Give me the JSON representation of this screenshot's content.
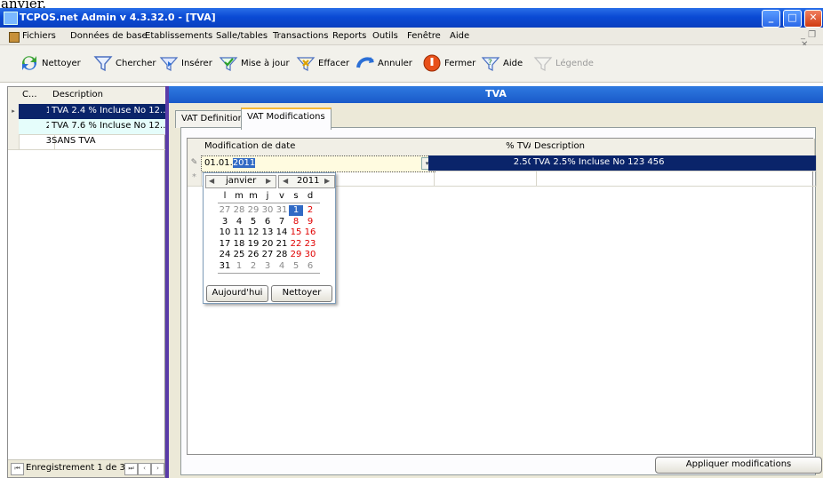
{
  "caption_fragment": "anvier.",
  "window": {
    "title": "TCPOS.net Admin v 4.3.32.0 - [TVA]"
  },
  "menu": [
    {
      "label": "Fichiers"
    },
    {
      "label": "Données de base"
    },
    {
      "label": "Etablissements"
    },
    {
      "label": "Salle/tables"
    },
    {
      "label": "Transactions"
    },
    {
      "label": "Reports"
    },
    {
      "label": "Outils"
    },
    {
      "label": "Fenêtre"
    },
    {
      "label": "Aide"
    }
  ],
  "toolbar": [
    {
      "label": "Nettoyer",
      "icon": "cleanup-icon"
    },
    {
      "label": "Chercher",
      "icon": "search-icon"
    },
    {
      "label": "Insérer",
      "icon": "insert-icon"
    },
    {
      "label": "Mise à jour",
      "icon": "update-icon"
    },
    {
      "label": "Effacer",
      "icon": "delete-icon"
    },
    {
      "label": "Annuler",
      "icon": "undo-icon"
    },
    {
      "label": "Fermer",
      "icon": "close-icon"
    },
    {
      "label": "Aide",
      "icon": "help-icon"
    },
    {
      "label": "Légende",
      "icon": "legend-icon"
    }
  ],
  "left_grid": {
    "headers": [
      "C...",
      "Description"
    ],
    "rows": [
      {
        "code": "1",
        "desc": "TVA 2.4 % Incluse No 12..."
      },
      {
        "code": "2",
        "desc": "TVA 7.6 % Incluse No 12..."
      },
      {
        "code": "3",
        "desc": "SANS TVA"
      }
    ],
    "footer": "Enregistrement 1 de 3"
  },
  "right": {
    "header": "TVA",
    "tabs": [
      "VAT Definition",
      "VAT Modifications"
    ],
    "grid": {
      "headers": [
        "Modification de date",
        "% TVA",
        "Description"
      ],
      "row": {
        "date_prefix": "01.01.",
        "date_selected": "2011",
        "pct": "2.50",
        "desc": "TVA 2.5% Incluse No 123 456"
      }
    },
    "apply_label": "Appliquer modifications"
  },
  "datepicker": {
    "month": "janvier",
    "year": "2011",
    "weekdays": [
      "l",
      "m",
      "m",
      "j",
      "v",
      "s",
      "d"
    ],
    "weeks": [
      [
        "27",
        "28",
        "29",
        "30",
        "31",
        "1",
        "2"
      ],
      [
        "3",
        "4",
        "5",
        "6",
        "7",
        "8",
        "9"
      ],
      [
        "10",
        "11",
        "12",
        "13",
        "14",
        "15",
        "16"
      ],
      [
        "17",
        "18",
        "19",
        "20",
        "21",
        "22",
        "23"
      ],
      [
        "24",
        "25",
        "26",
        "27",
        "28",
        "29",
        "30"
      ],
      [
        "31",
        "1",
        "2",
        "3",
        "4",
        "5",
        "6"
      ]
    ],
    "today_label": "Aujourd'hui",
    "clear_label": "Nettoyer",
    "colors": {
      "weekend": "#e00000",
      "selected": "#316ac5",
      "outside": "#8a8a8a"
    }
  }
}
